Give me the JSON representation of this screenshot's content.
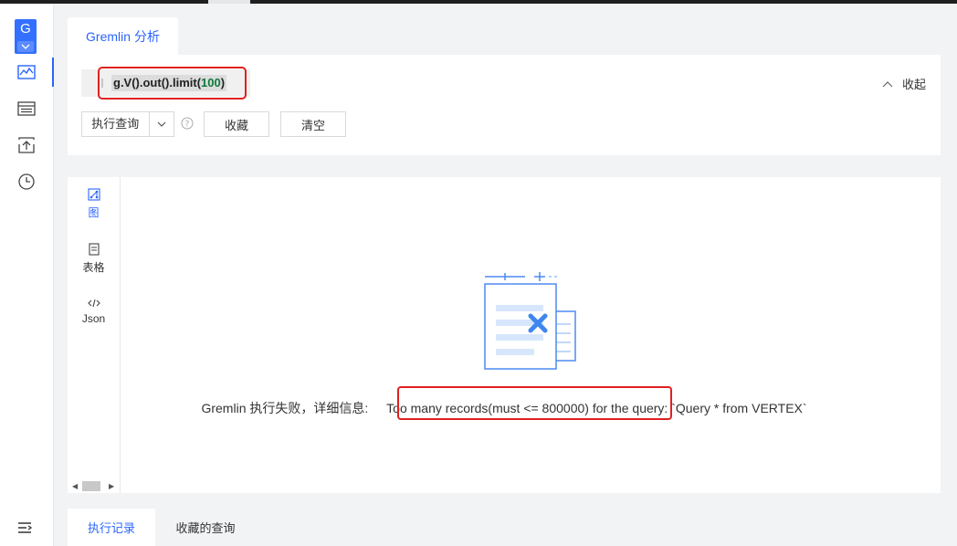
{
  "app": {
    "logo_letter": "G"
  },
  "sidebar": {
    "items": [
      {
        "name": "graph-analysis",
        "icon": "chart-line-icon",
        "active": true
      },
      {
        "name": "metadata",
        "icon": "table-list-icon",
        "active": false
      },
      {
        "name": "data-import",
        "icon": "upload-icon",
        "active": false
      },
      {
        "name": "history",
        "icon": "clock-icon",
        "active": false
      }
    ],
    "collapse_icon": "menu-collapse-icon"
  },
  "query_panel": {
    "tab_label": "Gremlin 分析",
    "editor": {
      "code_prefix": "g.V().out().limit(",
      "code_number": "100",
      "code_suffix": ")"
    },
    "collapse_label": "收起",
    "run_button": "执行查询",
    "favorite_button": "收藏",
    "clear_button": "清空"
  },
  "results_panel": {
    "view_tabs": [
      {
        "label": "图",
        "icon": "graph-icon",
        "active": true
      },
      {
        "label": "表格",
        "icon": "table-icon",
        "active": false
      },
      {
        "label": "Json",
        "icon": "code-icon",
        "active": false
      }
    ],
    "error_prefix": "Gremlin 执行失败，详细信息: ",
    "error_message": "Too many records(must <= 800000) for the query: `Query * from VERTEX`"
  },
  "bottom_tabs": [
    {
      "label": "执行记录",
      "active": true
    },
    {
      "label": "收藏的查询",
      "active": false
    }
  ],
  "colors": {
    "accent": "#2b65ff",
    "highlight_box": "#e02020"
  }
}
